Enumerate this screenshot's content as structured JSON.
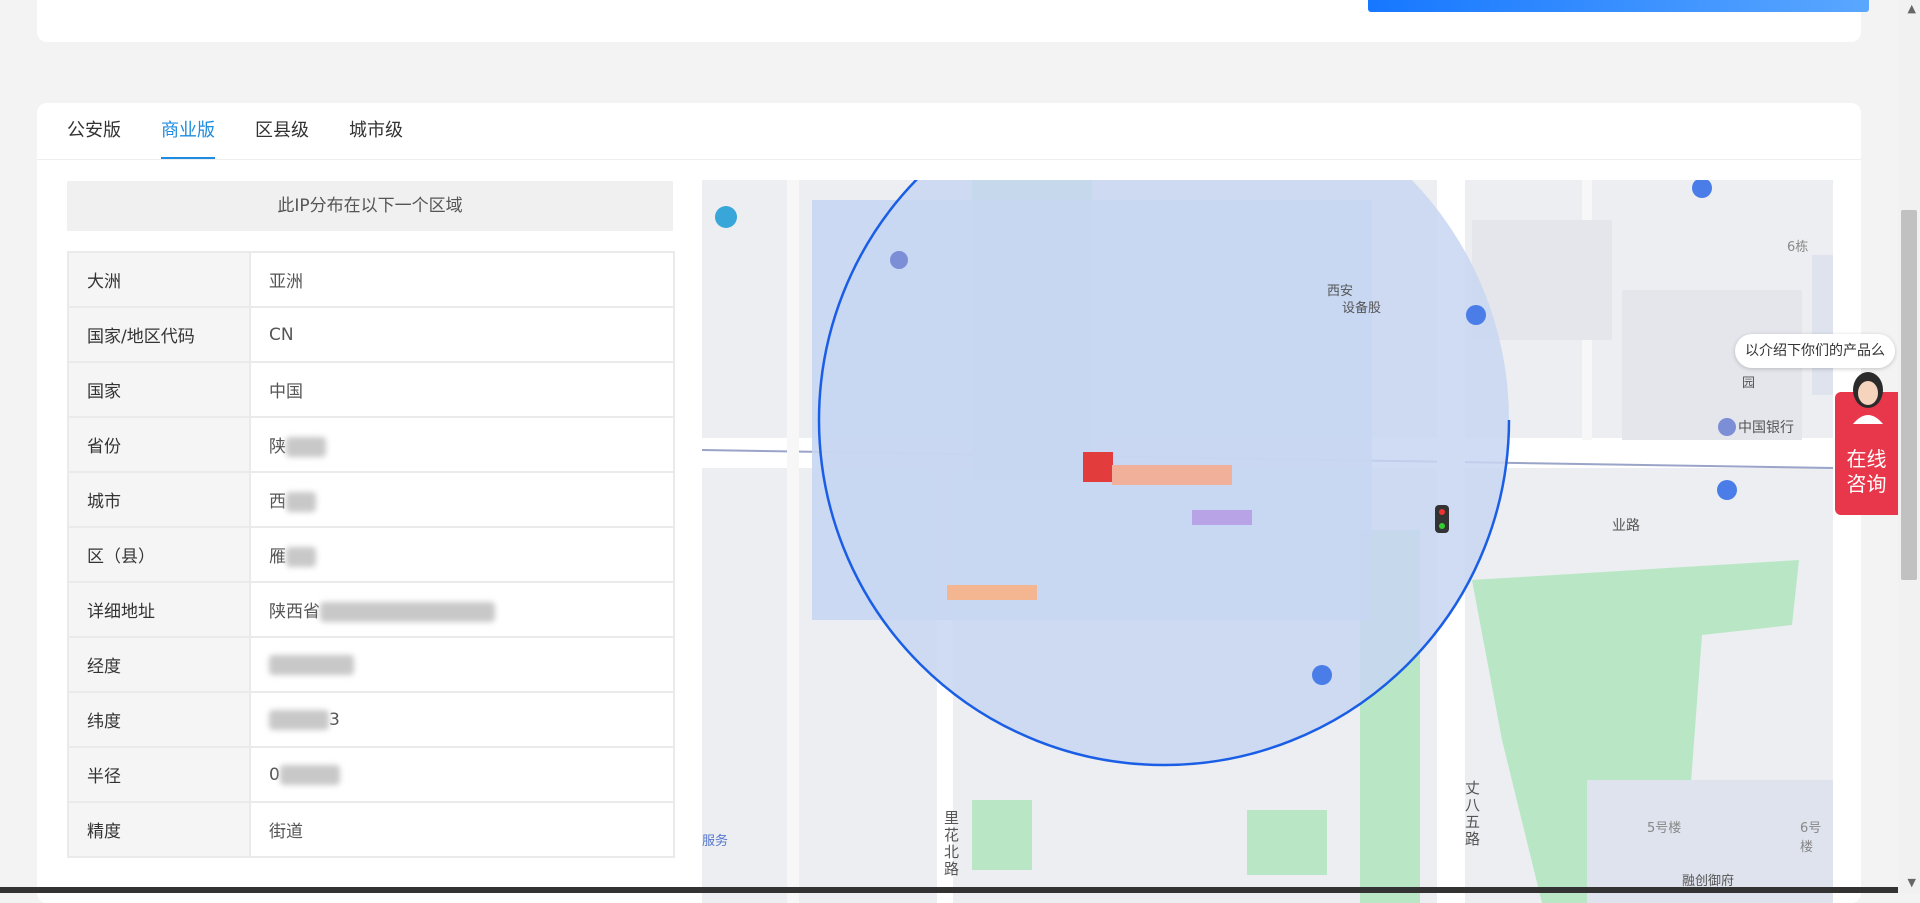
{
  "tabs": [
    {
      "label": "公安版",
      "active": false
    },
    {
      "label": "商业版",
      "active": true
    },
    {
      "label": "区县级",
      "active": false
    },
    {
      "label": "城市级",
      "active": false
    }
  ],
  "info": {
    "heading": "此IP分布在以下一个区域",
    "rows": [
      {
        "key": "大洲",
        "value": "亚洲"
      },
      {
        "key": "国家/地区代码",
        "value": "CN"
      },
      {
        "key": "国家",
        "value": "中国"
      },
      {
        "key": "省份",
        "value": "陕"
      },
      {
        "key": "城市",
        "value": "西"
      },
      {
        "key": "区（县）",
        "value": "雁"
      },
      {
        "key": "详细地址",
        "value": "陕西省"
      },
      {
        "key": "经度",
        "value": ""
      },
      {
        "key": "纬度",
        "value": "3"
      },
      {
        "key": "半径",
        "value": "0"
      },
      {
        "key": "精度",
        "value": "街道"
      }
    ]
  },
  "map": {
    "labels": {
      "bank": "中国银行",
      "road_east": "业路",
      "road_south": "丈八五路",
      "road_north": "里花北路",
      "building_6": "6栋",
      "building_5": "5号楼",
      "building_6b": "6号楼",
      "service": "服务",
      "west_company": "西安",
      "equipment": "设备股",
      "finance": "融创御府",
      "garden": "园"
    },
    "circle_color": "#1a5ee6",
    "fill_color": "#c8d6f2"
  },
  "chat": {
    "bubble": "以介绍下你们的产品么",
    "consult_line1": "在线",
    "consult_line2": "咨询",
    "accent": "#e8374a"
  }
}
